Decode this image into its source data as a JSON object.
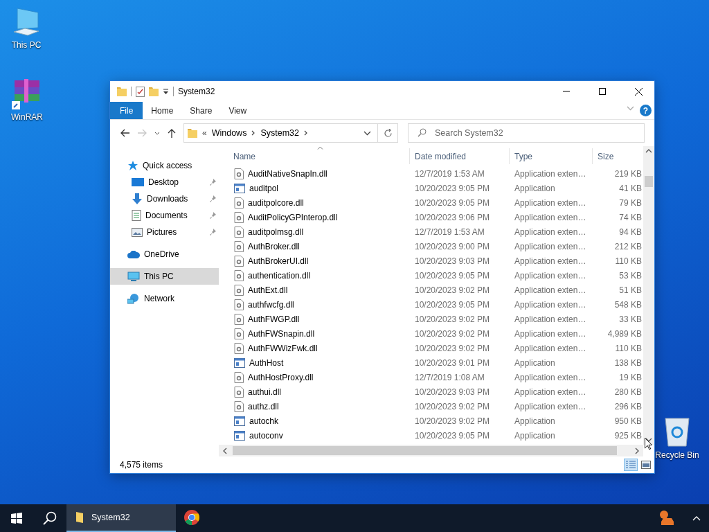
{
  "desktop_icons": [
    {
      "label": "This PC",
      "kind": "pc"
    },
    {
      "label": "WinRAR",
      "kind": "winrar"
    },
    {
      "label": "Recycle Bin",
      "kind": "bin"
    }
  ],
  "window": {
    "title": "System32",
    "ribbon_tabs": [
      {
        "label": "File",
        "selected": true
      },
      {
        "label": "Home",
        "selected": false
      },
      {
        "label": "Share",
        "selected": false
      },
      {
        "label": "View",
        "selected": false
      }
    ],
    "help": "?",
    "breadcrumb_overflow": "«",
    "breadcrumb": [
      "Windows",
      "System32"
    ],
    "search": {
      "placeholder": "Search System32"
    },
    "nav": [
      {
        "label": "Quick access",
        "kind": "quick",
        "pinned": false,
        "selected": false,
        "child": false
      },
      {
        "label": "Desktop",
        "kind": "desktop",
        "pinned": true,
        "selected": false,
        "child": true
      },
      {
        "label": "Downloads",
        "kind": "downloads",
        "pinned": true,
        "selected": false,
        "child": true
      },
      {
        "label": "Documents",
        "kind": "documents",
        "pinned": true,
        "selected": false,
        "child": true
      },
      {
        "label": "Pictures",
        "kind": "pictures",
        "pinned": true,
        "selected": false,
        "child": true
      },
      {
        "label": "OneDrive",
        "kind": "onedrive",
        "pinned": false,
        "selected": false,
        "child": false
      },
      {
        "label": "This PC",
        "kind": "pc",
        "pinned": false,
        "selected": true,
        "child": false
      },
      {
        "label": "Network",
        "kind": "network",
        "pinned": false,
        "selected": false,
        "child": false
      }
    ],
    "columns": [
      "Name",
      "Date modified",
      "Type",
      "Size"
    ],
    "rows": [
      {
        "name": "AuditNativeSnapIn.dll",
        "date": "12/7/2019 1:53 AM",
        "type": "Application exten…",
        "size": "219 KB",
        "kind": "dll"
      },
      {
        "name": "auditpol",
        "date": "10/20/2023 9:05 PM",
        "type": "Application",
        "size": "41 KB",
        "kind": "app"
      },
      {
        "name": "auditpolcore.dll",
        "date": "10/20/2023 9:05 PM",
        "type": "Application exten…",
        "size": "79 KB",
        "kind": "dll"
      },
      {
        "name": "AuditPolicyGPInterop.dll",
        "date": "10/20/2023 9:06 PM",
        "type": "Application exten…",
        "size": "74 KB",
        "kind": "dll"
      },
      {
        "name": "auditpolmsg.dll",
        "date": "12/7/2019 1:53 AM",
        "type": "Application exten…",
        "size": "94 KB",
        "kind": "dll"
      },
      {
        "name": "AuthBroker.dll",
        "date": "10/20/2023 9:00 PM",
        "type": "Application exten…",
        "size": "212 KB",
        "kind": "dll"
      },
      {
        "name": "AuthBrokerUI.dll",
        "date": "10/20/2023 9:03 PM",
        "type": "Application exten…",
        "size": "110 KB",
        "kind": "dll"
      },
      {
        "name": "authentication.dll",
        "date": "10/20/2023 9:05 PM",
        "type": "Application exten…",
        "size": "53 KB",
        "kind": "dll"
      },
      {
        "name": "AuthExt.dll",
        "date": "10/20/2023 9:02 PM",
        "type": "Application exten…",
        "size": "51 KB",
        "kind": "dll"
      },
      {
        "name": "authfwcfg.dll",
        "date": "10/20/2023 9:05 PM",
        "type": "Application exten…",
        "size": "548 KB",
        "kind": "dll"
      },
      {
        "name": "AuthFWGP.dll",
        "date": "10/20/2023 9:02 PM",
        "type": "Application exten…",
        "size": "33 KB",
        "kind": "dll"
      },
      {
        "name": "AuthFWSnapin.dll",
        "date": "10/20/2023 9:02 PM",
        "type": "Application exten…",
        "size": "4,989 KB",
        "kind": "dll"
      },
      {
        "name": "AuthFWWizFwk.dll",
        "date": "10/20/2023 9:02 PM",
        "type": "Application exten…",
        "size": "110 KB",
        "kind": "dll"
      },
      {
        "name": "AuthHost",
        "date": "10/20/2023 9:01 PM",
        "type": "Application",
        "size": "138 KB",
        "kind": "app"
      },
      {
        "name": "AuthHostProxy.dll",
        "date": "12/7/2019 1:08 AM",
        "type": "Application exten…",
        "size": "19 KB",
        "kind": "dll"
      },
      {
        "name": "authui.dll",
        "date": "10/20/2023 9:03 PM",
        "type": "Application exten…",
        "size": "280 KB",
        "kind": "dll"
      },
      {
        "name": "authz.dll",
        "date": "10/20/2023 9:02 PM",
        "type": "Application exten…",
        "size": "296 KB",
        "kind": "dll"
      },
      {
        "name": "autochk",
        "date": "10/20/2023 9:02 PM",
        "type": "Application",
        "size": "950 KB",
        "kind": "app"
      },
      {
        "name": "autoconv",
        "date": "10/20/2023 9:05 PM",
        "type": "Application",
        "size": "925 KB",
        "kind": "app"
      }
    ],
    "status": "4,575 items",
    "views": [
      {
        "kind": "details",
        "selected": true
      },
      {
        "kind": "large",
        "selected": false
      }
    ]
  },
  "taskbar": {
    "items": [
      {
        "kind": "explorer",
        "label": "System32",
        "selected": true
      },
      {
        "kind": "chrome",
        "selected": false
      }
    ]
  }
}
